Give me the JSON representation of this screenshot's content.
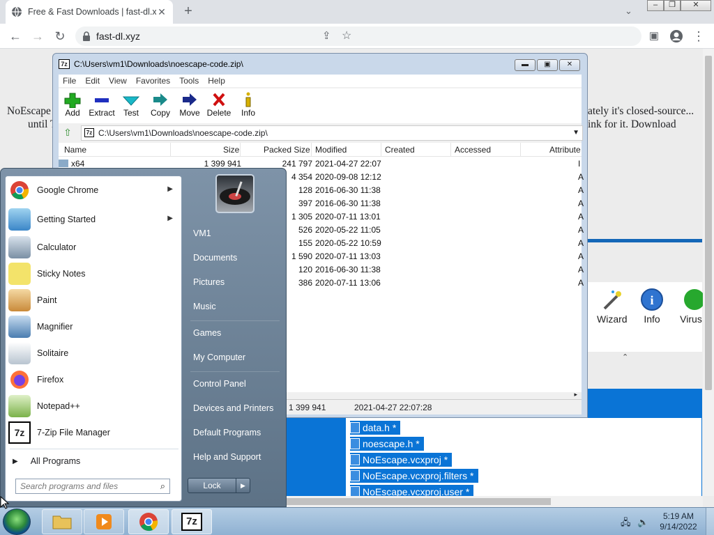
{
  "browser": {
    "tab_title": "Free & Fast Downloads | fast-dl.x",
    "tab_close": "✕",
    "new_tab": "+",
    "url": "fast-dl.xyz"
  },
  "page": {
    "text_left_1": "NoEscape",
    "text_left_2": "until T",
    "text_right_1": "ately it's closed-source...",
    "text_right_2": "ink for it. Download"
  },
  "bg_tools": [
    {
      "label": "Wizard",
      "icon": "wizard-icon"
    },
    {
      "label": "Info",
      "icon": "info-icon"
    },
    {
      "label": "Virus",
      "icon": "virus-icon"
    }
  ],
  "bg_files": [
    "data.h *",
    "noescape.h *",
    "NoEscape.vcxproj *",
    "NoEscape.vcxproj.filters *",
    "NoEscape.vcxproj.user *"
  ],
  "zip": {
    "title": "C:\\Users\\vm1\\Downloads\\noescape-code.zip\\",
    "menu": [
      "File",
      "Edit",
      "View",
      "Favorites",
      "Tools",
      "Help"
    ],
    "tools": [
      {
        "label": "Add",
        "icon": "plus-icon",
        "color": "#22aa22"
      },
      {
        "label": "Extract",
        "icon": "minus-icon",
        "color": "#1f2fbf"
      },
      {
        "label": "Test",
        "icon": "check-icon",
        "color": "#19b8c8"
      },
      {
        "label": "Copy",
        "icon": "copy-arrow-icon",
        "color": "#1a8a8a"
      },
      {
        "label": "Move",
        "icon": "move-arrow-icon",
        "color": "#1a2a8a"
      },
      {
        "label": "Delete",
        "icon": "delete-x-icon",
        "color": "#d01010"
      },
      {
        "label": "Info",
        "icon": "info-icon",
        "color": "#d6b000"
      }
    ],
    "address": "C:\\Users\\vm1\\Downloads\\noescape-code.zip\\",
    "columns": [
      "Name",
      "Size",
      "Packed Size",
      "Modified",
      "Created",
      "Accessed",
      "Attribute"
    ],
    "rows": [
      {
        "name": "x64",
        "size": "1 399 941",
        "packed": "241 797",
        "modified": "2021-04-27 22:07",
        "attr": "I"
      },
      {
        "name": "",
        "size": "",
        "packed": "4 354",
        "modified": "2020-09-08 12:12",
        "attr": "A"
      },
      {
        "name": "",
        "size": "",
        "packed": "128",
        "modified": "2016-06-30 11:38",
        "attr": "A"
      },
      {
        "name": "",
        "size": "",
        "packed": "397",
        "modified": "2016-06-30 11:38",
        "attr": "A"
      },
      {
        "name": "",
        "size": "",
        "packed": "1 305",
        "modified": "2020-07-11 13:01",
        "attr": "A"
      },
      {
        "name": "",
        "size": "",
        "packed": "526",
        "modified": "2020-05-22 11:05",
        "attr": "A"
      },
      {
        "name": "",
        "size": "",
        "packed": "155",
        "modified": "2020-05-22 10:59",
        "attr": "A"
      },
      {
        "name": "",
        "size": "",
        "packed": "1 590",
        "modified": "2020-07-11 13:03",
        "attr": "A"
      },
      {
        "name": "",
        "size": "",
        "packed": "120",
        "modified": "2016-06-30 11:38",
        "attr": "A"
      },
      {
        "name": "",
        "size": "",
        "packed": "386",
        "modified": "2020-07-11 13:06",
        "attr": "A"
      }
    ],
    "status_size": "1 399 941",
    "status_date": "2021-04-27 22:07:28"
  },
  "start": {
    "programs": [
      {
        "label": "Google Chrome",
        "icon": "chrome-icon",
        "submenu": true
      },
      {
        "label": "Getting Started",
        "icon": "getting-started-icon",
        "submenu": true
      },
      {
        "label": "Calculator",
        "icon": "calculator-icon",
        "submenu": false
      },
      {
        "label": "Sticky Notes",
        "icon": "sticky-notes-icon",
        "submenu": false
      },
      {
        "label": "Paint",
        "icon": "paint-icon",
        "submenu": false
      },
      {
        "label": "Magnifier",
        "icon": "magnifier-icon",
        "submenu": false
      },
      {
        "label": "Solitaire",
        "icon": "solitaire-icon",
        "submenu": false
      },
      {
        "label": "Firefox",
        "icon": "firefox-icon",
        "submenu": false
      },
      {
        "label": "Notepad++",
        "icon": "notepadpp-icon",
        "submenu": false
      },
      {
        "label": "7-Zip File Manager",
        "icon": "sevenzip-icon",
        "submenu": false
      }
    ],
    "all_programs": "All Programs",
    "search_placeholder": "Search programs and files",
    "right": [
      "VM1",
      "Documents",
      "Pictures",
      "Music",
      "Games",
      "My Computer",
      "Control Panel",
      "Devices and Printers",
      "Default Programs",
      "Help and Support"
    ],
    "lock": "Lock"
  },
  "taskbar": {
    "time": "5:19 AM",
    "date": "9/14/2022"
  }
}
